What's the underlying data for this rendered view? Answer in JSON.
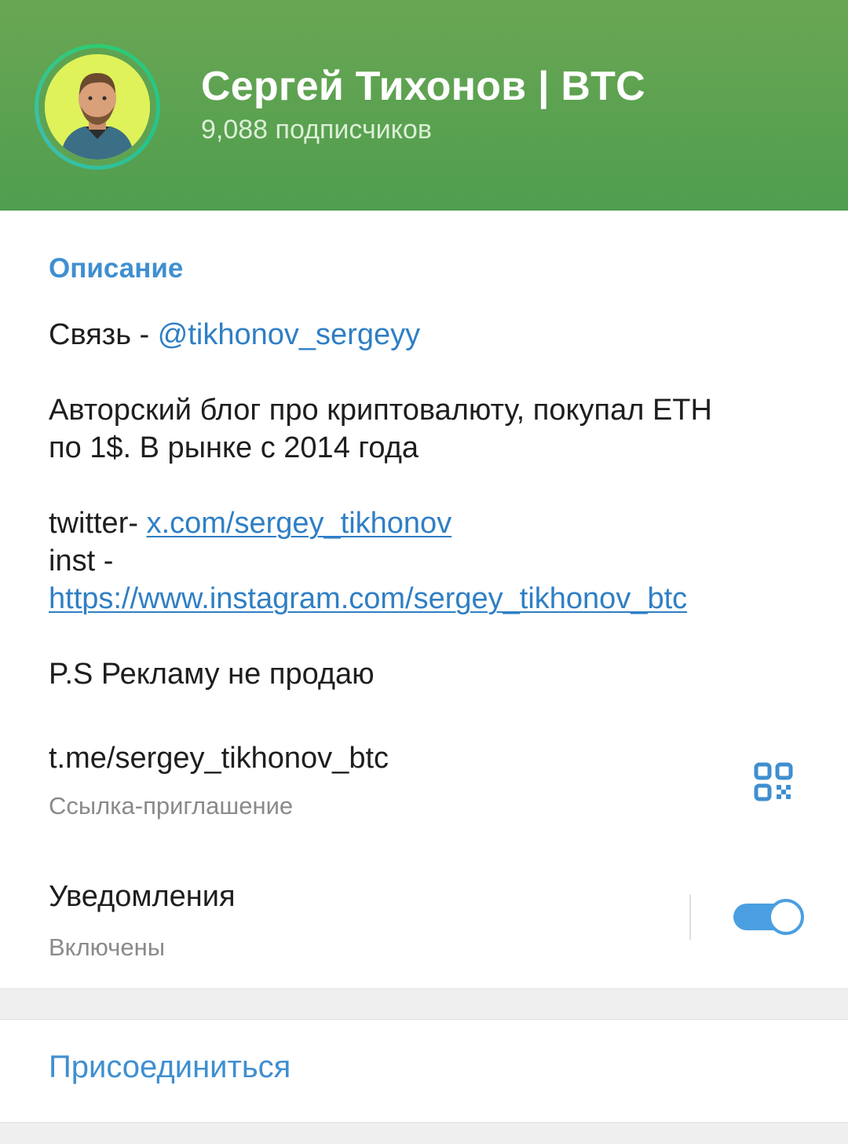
{
  "header": {
    "title": "Сергей Тихонов | BTC",
    "subscribers": "9,088 подписчиков"
  },
  "about": {
    "section_label": "Описание",
    "contact_prefix": "Связь - ",
    "contact_handle": "@tikhonov_sergeyy",
    "bio_line1": "Авторский блог про криптовалюту, покупал ETH",
    "bio_line2": "по 1$. В рынке с 2014 года",
    "twitter_prefix": "twitter- ",
    "twitter_link": "x.com/sergey_tikhonov",
    "inst_prefix": "inst -",
    "inst_link": "https://www.instagram.com/sergey_tikhonov_btc",
    "ps": "P.S Рекламу не продаю"
  },
  "invite": {
    "link": "t.me/sergey_tikhonov_btc",
    "label": "Ссылка-приглашение",
    "qr_icon": "qr-code-icon"
  },
  "notifications": {
    "label": "Уведомления",
    "status": "Включены",
    "enabled": true,
    "accent": "#4a9fe0"
  },
  "actions": {
    "join_label": "Присоединиться"
  },
  "colors": {
    "header_green": "#5ea352",
    "link_blue": "#2f7fc4",
    "section_blue": "#3f8fd0"
  }
}
